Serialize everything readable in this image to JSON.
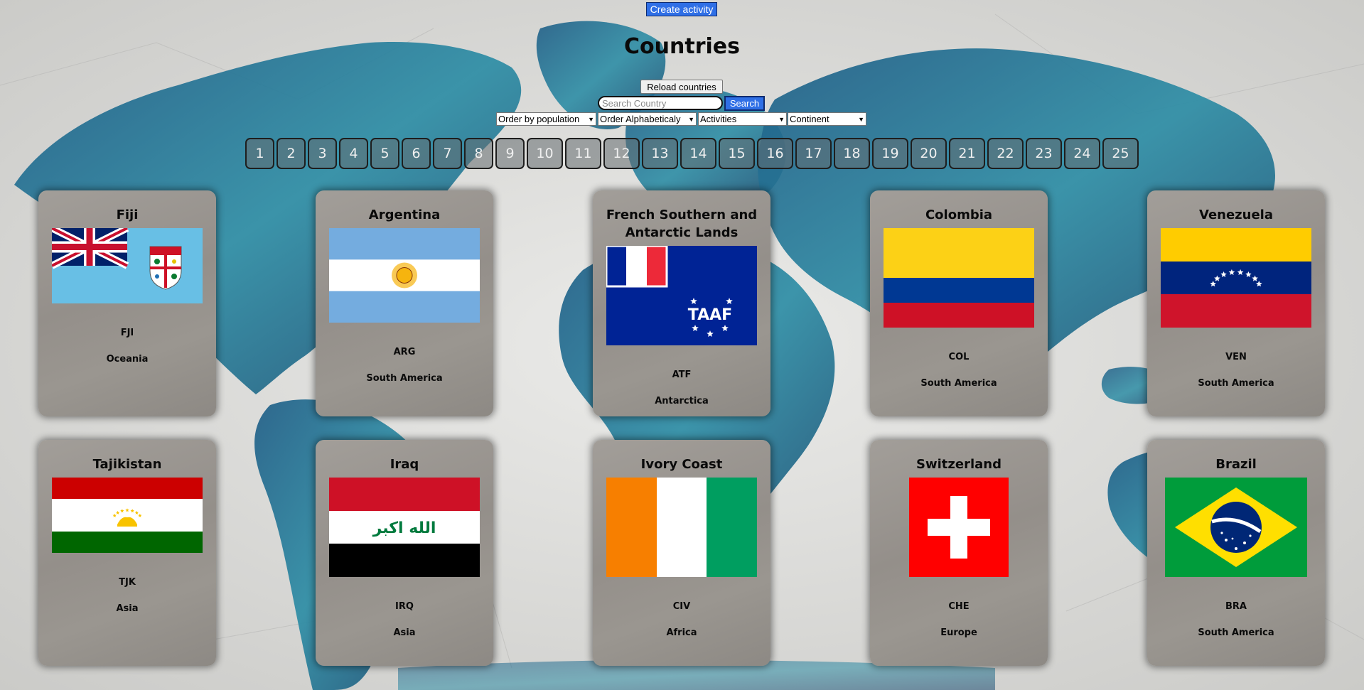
{
  "header": {
    "create_label": "Create activity",
    "title": "Countries",
    "reload_label": "Reload countries",
    "search_placeholder": "Search Country",
    "search_value": "",
    "search_label": "Search"
  },
  "filters": {
    "population": "Order by population",
    "alphabetical": "Order Alphabeticaly",
    "activities": "Activities",
    "continent": "Continent"
  },
  "pagination": [
    "1",
    "2",
    "3",
    "4",
    "5",
    "6",
    "7",
    "8",
    "9",
    "10",
    "11",
    "12",
    "13",
    "14",
    "15",
    "16",
    "17",
    "18",
    "19",
    "20",
    "21",
    "22",
    "23",
    "24",
    "25"
  ],
  "countries": [
    {
      "name": "Fiji",
      "code": "FJI",
      "continent": "Oceania",
      "flag": "fiji-flag"
    },
    {
      "name": "Argentina",
      "code": "ARG",
      "continent": "South America",
      "flag": "argentina-flag"
    },
    {
      "name": "French Southern and Antarctic Lands",
      "code": "ATF",
      "continent": "Antarctica",
      "flag": "french-southern-lands-flag"
    },
    {
      "name": "Colombia",
      "code": "COL",
      "continent": "South America",
      "flag": "colombia-flag"
    },
    {
      "name": "Venezuela",
      "code": "VEN",
      "continent": "South America",
      "flag": "venezuela-flag"
    },
    {
      "name": "Tajikistan",
      "code": "TJK",
      "continent": "Asia",
      "flag": "tajikistan-flag"
    },
    {
      "name": "Iraq",
      "code": "IRQ",
      "continent": "Asia",
      "flag": "iraq-flag"
    },
    {
      "name": "Ivory Coast",
      "code": "CIV",
      "continent": "Africa",
      "flag": "ivory-coast-flag"
    },
    {
      "name": "Switzerland",
      "code": "CHE",
      "continent": "Europe",
      "flag": "switzerland-flag"
    },
    {
      "name": "Brazil",
      "code": "BRA",
      "continent": "South America",
      "flag": "brazil-flag"
    }
  ],
  "flag_text": {
    "atf_monogram": "TAAF",
    "iraq_script": "الله اكبر"
  },
  "colors": {
    "button_blue": "#2f6fe6",
    "map_teal": "#2f8ea3",
    "map_deep": "#1d4a6e"
  }
}
